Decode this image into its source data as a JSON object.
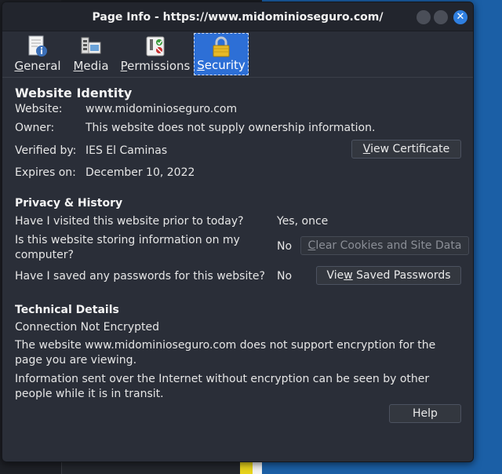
{
  "window": {
    "title": "Page Info - https://www.midominioseguro.com/",
    "close_glyph": "✕"
  },
  "tabs": [
    {
      "label": "General",
      "mnemonic": "G",
      "rest": "eneral",
      "icon": "page-info-icon"
    },
    {
      "label": "Media",
      "mnemonic": "M",
      "rest": "edia",
      "icon": "media-icon"
    },
    {
      "label": "Permissions",
      "mnemonic": "P",
      "rest": "ermissions",
      "icon": "permissions-icon"
    },
    {
      "label": "Security",
      "mnemonic": "S",
      "rest": "ecurity",
      "icon": "lock-icon",
      "active": true
    }
  ],
  "identity": {
    "heading": "Website Identity",
    "website_label": "Website:",
    "website_value": "www.midominioseguro.com",
    "owner_label": "Owner:",
    "owner_value": "This website does not supply ownership information.",
    "verified_label": "Verified by:",
    "verified_value": "IES El Caminas",
    "expires_label": "Expires on:",
    "expires_value": "December 10, 2022",
    "view_certificate_pre": "",
    "view_certificate_mn": "V",
    "view_certificate_post": "iew Certificate"
  },
  "privacy": {
    "heading": "Privacy & History",
    "q1": "Have I visited this website prior to today?",
    "a1": "Yes, once",
    "q2": "Is this website storing information on my computer?",
    "a2": "No",
    "clear_pre": "",
    "clear_mn": "C",
    "clear_post": "lear Cookies and Site Data",
    "q3": "Have I saved any passwords for this website?",
    "a3": "No",
    "view_pw_pre": "Vie",
    "view_pw_mn": "w",
    "view_pw_post": " Saved Passwords"
  },
  "technical": {
    "heading": "Technical Details",
    "status": "Connection Not Encrypted",
    "p1": "The website www.midominioseguro.com does not support encryption for the page you are viewing.",
    "p2": "Information sent over the Internet without encryption can be seen by other people while it is in transit."
  },
  "help_label": "Help",
  "colors": {
    "accent": "#2d6fd6",
    "window_bg": "#2a2e38"
  }
}
